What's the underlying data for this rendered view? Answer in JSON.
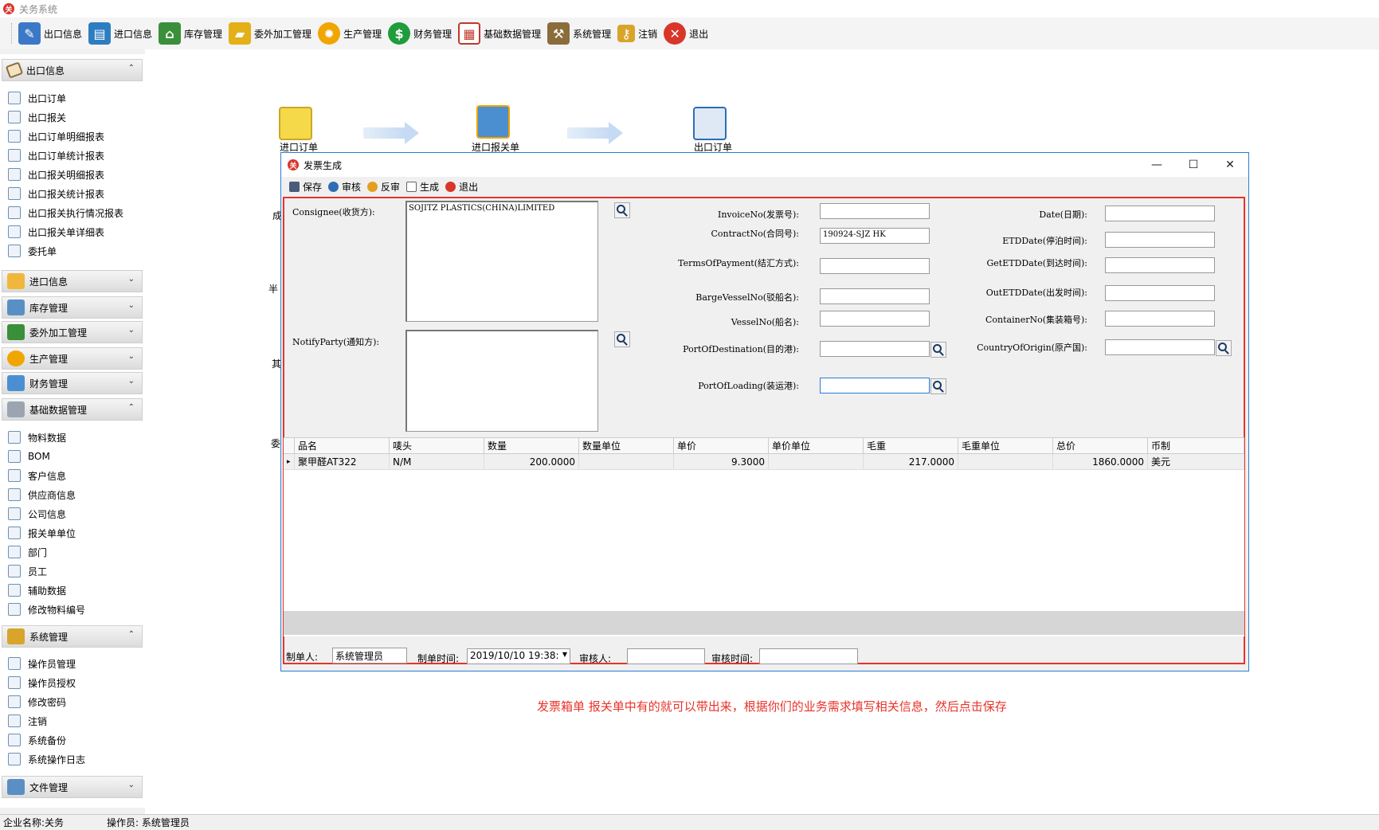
{
  "app": {
    "title": "关务系统"
  },
  "toolbar": [
    {
      "label": "出口信息",
      "icon": "edit-icon",
      "color": "#3c78c8"
    },
    {
      "label": "进口信息",
      "icon": "basket-icon",
      "color": "#2f7dc1"
    },
    {
      "label": "库存管理",
      "icon": "warehouse-icon",
      "color": "#3a8f3a"
    },
    {
      "label": "委外加工管理",
      "icon": "folder-icon",
      "color": "#e3b019"
    },
    {
      "label": "生产管理",
      "icon": "gear-icon",
      "color": "#f0a500"
    },
    {
      "label": "财务管理",
      "icon": "dollar-icon",
      "color": "#1f9c3b"
    },
    {
      "label": "基础数据管理",
      "icon": "calendar-icon",
      "color": "#c0392b"
    },
    {
      "label": "系统管理",
      "icon": "tools-icon",
      "color": "#8a6d3b"
    },
    {
      "label": "注销",
      "icon": "key-icon",
      "color": "#d8a42a"
    },
    {
      "label": "退出",
      "icon": "close-icon",
      "color": "#d9362a"
    }
  ],
  "sidebar": {
    "groups": [
      {
        "label": "出口信息",
        "chev": "⌃"
      },
      {
        "label": "进口信息",
        "chev": "⌄"
      },
      {
        "label": "库存管理",
        "chev": "⌄"
      },
      {
        "label": "委外加工管理",
        "chev": "⌄"
      },
      {
        "label": "生产管理",
        "chev": "⌄"
      },
      {
        "label": "财务管理",
        "chev": "⌄"
      },
      {
        "label": "基础数据管理",
        "chev": "⌃"
      },
      {
        "label": "系统管理",
        "chev": "⌃"
      },
      {
        "label": "文件管理",
        "chev": "⌄"
      }
    ],
    "export_items": [
      "出口订单",
      "出口报关",
      "出口订单明细报表",
      "出口订单统计报表",
      "出口报关明细报表",
      "出口报关统计报表",
      "出口报关执行情况报表",
      "出口报关单详细表",
      "委托单"
    ],
    "basic_items": [
      "物料数据",
      "BOM",
      "客户信息",
      "供应商信息",
      "公司信息",
      "报关单单位",
      "部门",
      "员工",
      "辅助数据",
      "修改物料编号"
    ],
    "system_items": [
      "操作员管理",
      "操作员授权",
      "修改密码",
      "注销",
      "系统备份",
      "系统操作日志"
    ]
  },
  "flow": {
    "node1": "进口订单",
    "node2": "进口报关单",
    "node3": "出口订单",
    "partial": [
      "成",
      "半",
      "其",
      "委"
    ]
  },
  "dialog": {
    "title": "发票生成",
    "tools": [
      "保存",
      "审核",
      "反审",
      "生成",
      "退出"
    ],
    "form": {
      "consignee_label": "Consignee(收货方):",
      "consignee_value": "SOJITZ PLASTICS(CHINA)LIMITED",
      "notify_label": "NotifyParty(通知方):",
      "invoice_label": "InvoiceNo(发票号):",
      "invoice_value": "",
      "contract_label": "ContractNo(合同号):",
      "contract_value": "190924-SJZ HK",
      "terms_label": "TermsOfPayment(结汇方式):",
      "terms_value": "",
      "barge_label": "BargeVesselNo(驳船名):",
      "barge_value": "",
      "vessel_label": "VesselNo(船名):",
      "vessel_value": "",
      "dest_label": "PortOfDestination(目的港):",
      "dest_value": "",
      "loading_label": "PortOfLoading(装运港):",
      "loading_value": "",
      "date_label": "Date(日期):",
      "date_value": "",
      "etd_label": "ETDDate(停泊时间):",
      "etd_value": "",
      "getetd_label": "GetETDDate(到达时间):",
      "getetd_value": "",
      "outetd_label": "OutETDDate(出发时间):",
      "outetd_value": "",
      "container_label": "ContainerNo(集装箱号):",
      "container_value": "",
      "origin_label": "CountryOfOrigin(原产国):",
      "origin_value": ""
    },
    "grid": {
      "columns": [
        "品名",
        "唛头",
        "数量",
        "数量单位",
        "单价",
        "单价单位",
        "毛重",
        "毛重单位",
        "总价",
        "币制"
      ],
      "rows": [
        [
          "聚甲醛AT322",
          "N/M",
          "200.0000",
          "",
          "9.3000",
          "",
          "217.0000",
          "",
          "1860.0000",
          "美元"
        ]
      ],
      "row_marker": "▸"
    },
    "footer": {
      "maker_label": "制单人:",
      "maker_value": "系统管理员",
      "maketime_label": "制单时间:",
      "maketime_value": "2019/10/10 19:38:",
      "auditor_label": "审核人:",
      "auditor_value": "",
      "audittime_label": "审核时间:",
      "audittime_value": ""
    }
  },
  "note": "发票箱单  报关单中有的就可以带出来，根据你们的业务需求填写相关信息，然后点击保存",
  "status": {
    "company": "企业名称:关务",
    "operator": "操作员: 系统管理员"
  }
}
